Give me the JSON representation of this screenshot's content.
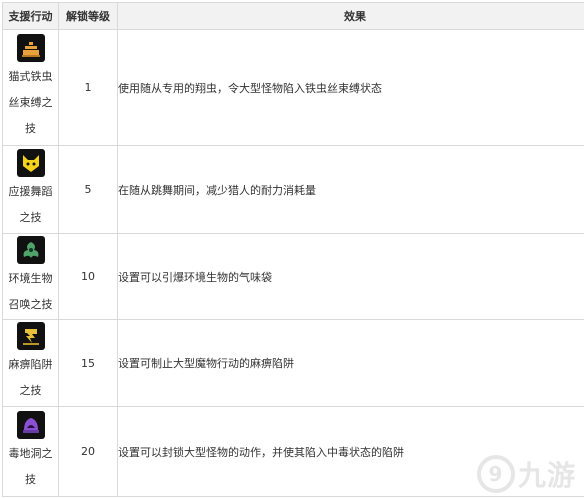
{
  "table": {
    "headers": [
      "支援行动",
      "解锁等级",
      "效果"
    ],
    "rows": [
      {
        "icon": "cat-bug-icon",
        "name_lines": [
          "猫式铁虫",
          "丝束缚之",
          "技"
        ],
        "level": "1",
        "effect": "使用随从专用的翔虫，令大型怪物陷入铁虫丝束缚状态"
      },
      {
        "icon": "cheer-dance-icon",
        "name_lines": [
          "应援舞蹈",
          "之技"
        ],
        "level": "5",
        "effect": "在随从跳舞期间，减少猎人的耐力消耗量"
      },
      {
        "icon": "envir-creature-icon",
        "name_lines": [
          "环境生物",
          "召唤之技"
        ],
        "level": "10",
        "effect": "设置可以引爆环境生物的气味袋"
      },
      {
        "icon": "paralysis-trap-icon",
        "name_lines": [
          "麻痹陷阱",
          "之技"
        ],
        "level": "15",
        "effect": "设置可制止大型魔物行动的麻痹陷阱"
      },
      {
        "icon": "poison-pit-icon",
        "name_lines": [
          "毒地洞之",
          "技"
        ],
        "level": "20",
        "effect": "设置可以封锁大型怪物的动作，并使其陷入中毒状态的陷阱"
      }
    ]
  },
  "watermark": {
    "text": "九游"
  }
}
